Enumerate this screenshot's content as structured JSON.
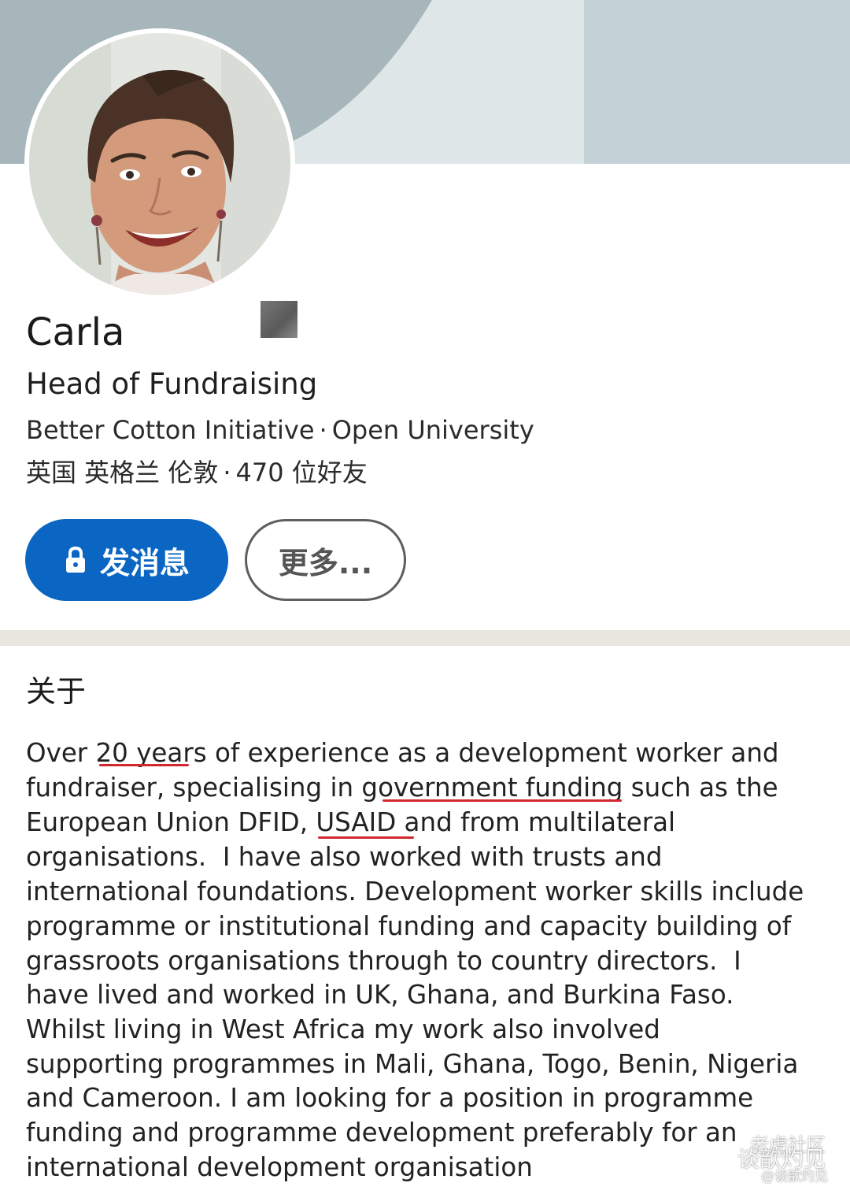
{
  "profile": {
    "name": "Carla",
    "headline": "Head of Fundraising",
    "organization": "Better Cotton Initiative",
    "education": "Open University",
    "location": "英国 英格兰 伦敦",
    "connections": "470 位好友",
    "separator": "·"
  },
  "actions": {
    "message_label": "发消息",
    "more_label": "更多..."
  },
  "about": {
    "heading": "关于",
    "lines": [
      "Over 20 years of experience as a development worker and",
      "fundraiser, specialising in government funding such as the",
      "European Union DFID, USAID and from multilateral",
      "organisations.  I have also worked with trusts and",
      "international foundations. Development worker skills include",
      "programme or institutional funding and capacity building of",
      "grassroots organisations through to country directors.  I",
      "have lived and worked in UK, Ghana, and Burkina Faso.",
      "Whilst living in West Africa my work also involved",
      "supporting programmes in Mali, Ghana, Togo, Benin, Nigeria",
      "and Cameroon. I am looking for a position in programme",
      "funding and programme development preferably for an",
      "international development organisation"
    ],
    "highlighted_phrases": [
      "20 years",
      "government funding",
      "USAID"
    ]
  },
  "watermark": {
    "line1": "老虎社区",
    "line2": "谈歆灼见",
    "line3": "@谈歆灼见"
  },
  "colors": {
    "primary_button": "#0a66c2",
    "underline_marker": "#d3272f",
    "banner_dark": "#a6b6ba",
    "banner_light": "#dfe6e7"
  },
  "icons": {
    "message_button_icon": "lock-icon",
    "watermark_icon": "chat-bubbles-icon"
  }
}
